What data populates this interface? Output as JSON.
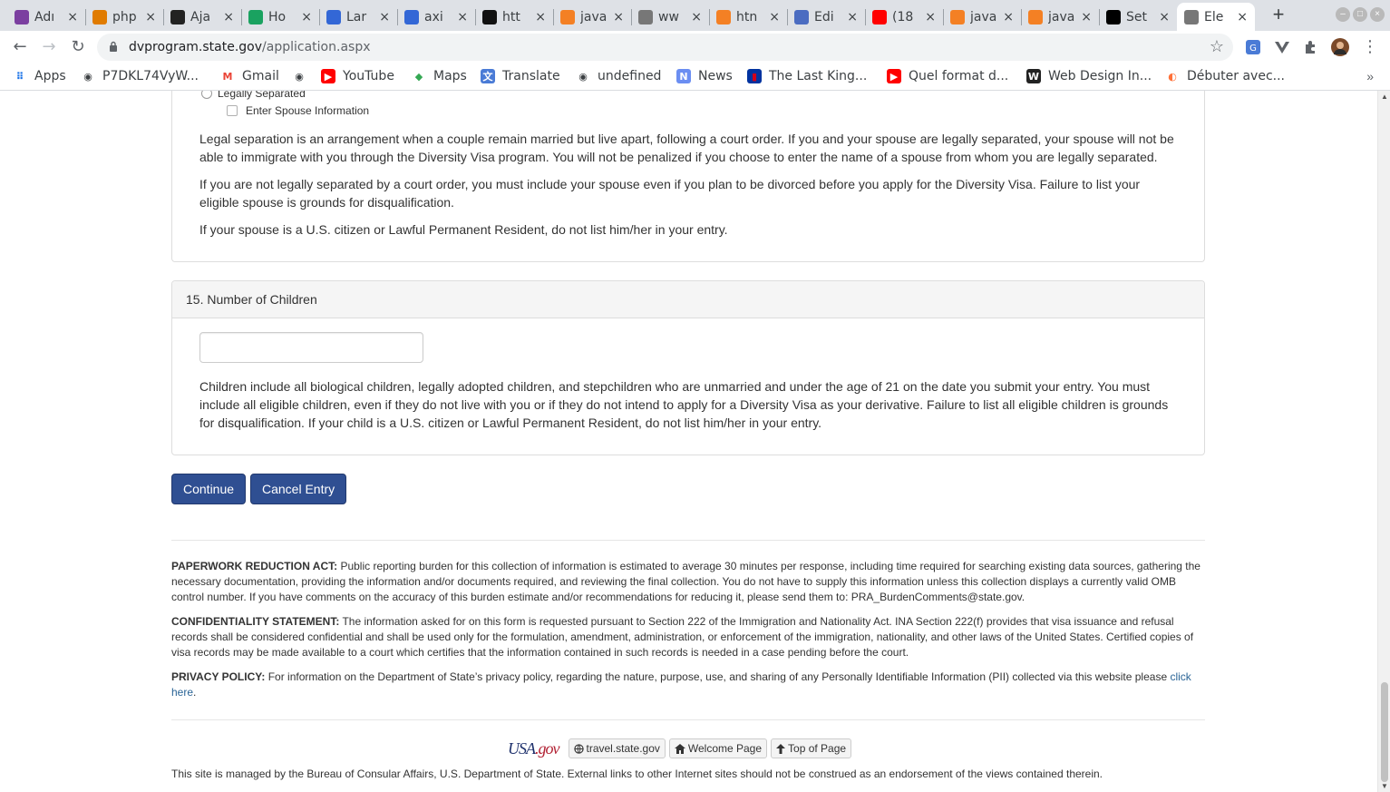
{
  "browser": {
    "tabs": [
      {
        "label": "Adı",
        "fav_color": "#7b3fa0"
      },
      {
        "label": "php",
        "fav_color": "#e07b00"
      },
      {
        "label": "Aja",
        "fav_color": "#222222"
      },
      {
        "label": "Ho",
        "fav_color": "#1aa260"
      },
      {
        "label": "Lar",
        "fav_color": "#3367d6"
      },
      {
        "label": "axi",
        "fav_color": "#3367d6"
      },
      {
        "label": "htt",
        "fav_color": "#111111"
      },
      {
        "label": "java",
        "fav_color": "#f48024"
      },
      {
        "label": "ww",
        "fav_color": "#777777"
      },
      {
        "label": "htn",
        "fav_color": "#f48024"
      },
      {
        "label": "Edi",
        "fav_color": "#4b6cc1"
      },
      {
        "label": "(18",
        "fav_color": "#ff0000"
      },
      {
        "label": "java",
        "fav_color": "#f48024"
      },
      {
        "label": "java",
        "fav_color": "#f48024"
      },
      {
        "label": "Set",
        "fav_color": "#000000"
      },
      {
        "label": "Ele",
        "fav_color": "#777777"
      }
    ],
    "url_host": "dvprogram.state.gov",
    "url_path": "/application.aspx",
    "bookmarks": [
      {
        "label": "Apps",
        "icon": "apps-grid-icon"
      },
      {
        "label": "P7DKL74VyW...",
        "icon": "globe-icon"
      },
      {
        "label": "Gmail",
        "icon": "gmail-icon"
      },
      {
        "label": "",
        "icon": "globe-icon"
      },
      {
        "label": "YouTube",
        "icon": "youtube-icon"
      },
      {
        "label": "Maps",
        "icon": "maps-icon"
      },
      {
        "label": "Translate",
        "icon": "translate-icon"
      },
      {
        "label": "undefined",
        "icon": "globe-icon"
      },
      {
        "label": "News",
        "icon": "news-icon"
      },
      {
        "label": "The Last King...",
        "icon": "flag-icon"
      },
      {
        "label": "Quel format d...",
        "icon": "youtube-icon"
      },
      {
        "label": "Web Design In...",
        "icon": "w-icon"
      },
      {
        "label": "Débuter avec...",
        "icon": "firefox-icon"
      }
    ],
    "bookmarks_more": "»"
  },
  "section14": {
    "radio_label": "Legally Separated",
    "checkbox_label": "Enter Spouse Information",
    "paragraphs": [
      "Legal separation is an arrangement when a couple remain married but live apart, following a court order. If you and your spouse are legally separated, your spouse will not be able to immigrate with you through the Diversity Visa program. You will not be penalized if you choose to enter the name of a spouse from whom you are legally separated.",
      "If you are not legally separated by a court order, you must include your spouse even if you plan to be divorced before you apply for the Diversity Visa. Failure to list your eligible spouse is grounds for disqualification.",
      "If your spouse is a U.S. citizen or Lawful Permanent Resident, do not list him/her in your entry."
    ]
  },
  "section15": {
    "title": "15. Number of Children",
    "input_value": "",
    "paragraph": "Children include all biological children, legally adopted children, and stepchildren who are unmarried and under the age of 21 on the date you submit your entry. You must include all eligible children, even if they do not live with you or if they do not intend to apply for a Diversity Visa as your derivative. Failure to list all eligible children is grounds for disqualification. If your child is a U.S. citizen or Lawful Permanent Resident, do not list him/her in your entry."
  },
  "actions": {
    "continue": "Continue",
    "cancel": "Cancel Entry"
  },
  "footer": {
    "paperwork_title": "PAPERWORK REDUCTION ACT:",
    "paperwork_text": " Public reporting burden for this collection of information is estimated to average 30 minutes per response, including time required for searching existing data sources, gathering the necessary documentation, providing the information and/or documents required, and reviewing the final collection. You do not have to supply this information unless this collection displays a currently valid OMB control number. If you have comments on the accuracy of this burden estimate and/or recommendations for reducing it, please send them to: PRA_BurdenComments@state.gov.",
    "confidentiality_title": "CONFIDENTIALITY STATEMENT:",
    "confidentiality_text": " The information asked for on this form is requested pursuant to Section 222 of the Immigration and Nationality Act. INA Section 222(f) provides that visa issuance and refusal records shall be considered confidential and shall be used only for the formulation, amendment, administration, or enforcement of the immigration, nationality, and other laws of the United States. Certified copies of visa records may be made available to a court which certifies that the information contained in such records is needed in a case pending before the court.",
    "privacy_title": "PRIVACY POLICY:",
    "privacy_text": " For information on the Department of State’s privacy policy, regarding the nature, purpose, use, and sharing of any Personally Identifiable Information (PII) collected via this website please ",
    "privacy_link": "click here",
    "privacy_end": ".",
    "usa_logo": "USA.gov",
    "links": [
      "travel.state.gov",
      "Welcome Page",
      "Top of Page"
    ],
    "managed": "This site is managed by the Bureau of Consular Affairs, U.S. Department of State. External links to other Internet sites should not be construed as an endorsement of the views contained therein."
  }
}
